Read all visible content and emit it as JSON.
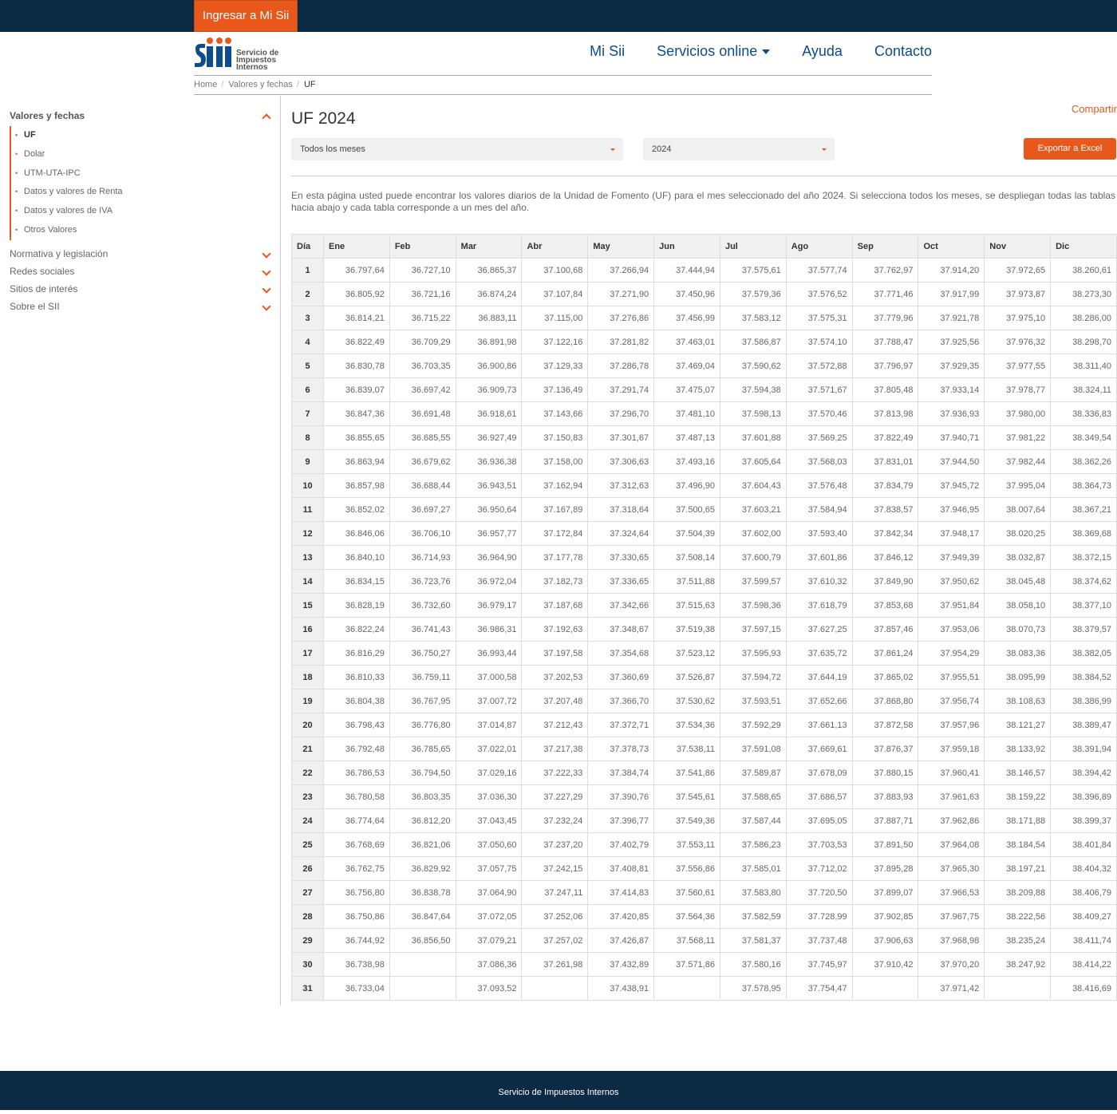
{
  "topbar": {
    "login_label": "Ingresar a Mi Sii"
  },
  "logo": {
    "line1": "Servicio de",
    "line2": "Impuestos",
    "line3": "Internos"
  },
  "nav": {
    "mi_sii": "Mi Sii",
    "servicios": "Servicios online",
    "ayuda": "Ayuda",
    "contacto": "Contacto"
  },
  "breadcrumb": {
    "home": "Home",
    "valores": "Valores y fechas",
    "current": "UF"
  },
  "sidebar": {
    "heading": "Valores y fechas",
    "items": [
      "UF",
      "Dolar",
      "UTM-UTA-IPC",
      "Datos y valores de Renta",
      "Datos y valores de IVA",
      "Otros Valores"
    ],
    "sections": [
      "Normativa y legislación",
      "Redes sociales",
      "Sitios de interés",
      "Sobre el SII"
    ]
  },
  "main": {
    "title": "UF 2024",
    "share": "Compartir",
    "month_select": "Todos los meses",
    "year_select": "2024",
    "export_label": "Exportar a Excel",
    "description": "En esta página usted puede encontrar los valores diarios de la Unidad de Fomento (UF) para el mes seleccionado del año 2024. Si selecciona todos los meses, se despliegan todas las tablas hacia abajo y cada tabla corresponde a un mes del año."
  },
  "table": {
    "headers": [
      "Día",
      "Ene",
      "Feb",
      "Mar",
      "Abr",
      "May",
      "Jun",
      "Jul",
      "Ago",
      "Sep",
      "Oct",
      "Nov",
      "Dic"
    ],
    "rows": [
      [
        "1",
        "36.797,64",
        "36.727,10",
        "36.865,37",
        "37.100,68",
        "37.266,94",
        "37.444,94",
        "37.575,61",
        "37.577,74",
        "37.762,97",
        "37.914,20",
        "37.972,65",
        "38.260,61"
      ],
      [
        "2",
        "36.805,92",
        "36.721,16",
        "36.874,24",
        "37.107,84",
        "37.271,90",
        "37.450,96",
        "37.579,36",
        "37.576,52",
        "37.771,46",
        "37.917,99",
        "37.973,87",
        "38.273,30"
      ],
      [
        "3",
        "36.814,21",
        "36.715,22",
        "36.883,11",
        "37.115,00",
        "37.276,86",
        "37.456,99",
        "37.583,12",
        "37.575,31",
        "37.779,96",
        "37.921,78",
        "37.975,10",
        "38.286,00"
      ],
      [
        "4",
        "36.822,49",
        "36.709,29",
        "36.891,98",
        "37.122,16",
        "37.281,82",
        "37.463,01",
        "37.586,87",
        "37.574,10",
        "37.788,47",
        "37.925,56",
        "37.976,32",
        "38.298,70"
      ],
      [
        "5",
        "36.830,78",
        "36.703,35",
        "36.900,86",
        "37.129,33",
        "37.286,78",
        "37.469,04",
        "37.590,62",
        "37.572,88",
        "37.796,97",
        "37.929,35",
        "37.977,55",
        "38.311,40"
      ],
      [
        "6",
        "36.839,07",
        "36.697,42",
        "36.909,73",
        "37.136,49",
        "37.291,74",
        "37.475,07",
        "37.594,38",
        "37.571,67",
        "37.805,48",
        "37.933,14",
        "37.978,77",
        "38.324,11"
      ],
      [
        "7",
        "36.847,36",
        "36.691,48",
        "36.918,61",
        "37.143,66",
        "37.296,70",
        "37.481,10",
        "37.598,13",
        "37.570,46",
        "37.813,98",
        "37.936,93",
        "37.980,00",
        "38.336,83"
      ],
      [
        "8",
        "36.855,65",
        "36.685,55",
        "36.927,49",
        "37.150,83",
        "37.301,67",
        "37.487,13",
        "37.601,88",
        "37.569,25",
        "37.822,49",
        "37.940,71",
        "37.981,22",
        "38.349,54"
      ],
      [
        "9",
        "36.863,94",
        "36.679,62",
        "36.936,38",
        "37.158,00",
        "37.306,63",
        "37.493,16",
        "37.605,64",
        "37.568,03",
        "37.831,01",
        "37.944,50",
        "37.982,44",
        "38.362,26"
      ],
      [
        "10",
        "36.857,98",
        "36.688,44",
        "36.943,51",
        "37.162,94",
        "37.312,63",
        "37.496,90",
        "37.604,43",
        "37.576,48",
        "37.834,79",
        "37.945,72",
        "37.995,04",
        "38.364,73"
      ],
      [
        "11",
        "36.852,02",
        "36.697,27",
        "36.950,64",
        "37.167,89",
        "37.318,64",
        "37.500,65",
        "37.603,21",
        "37.584,94",
        "37.838,57",
        "37.946,95",
        "38.007,64",
        "38.367,21"
      ],
      [
        "12",
        "36.846,06",
        "36.706,10",
        "36.957,77",
        "37.172,84",
        "37.324,64",
        "37.504,39",
        "37.602,00",
        "37.593,40",
        "37.842,34",
        "37.948,17",
        "38.020,25",
        "38.369,68"
      ],
      [
        "13",
        "36.840,10",
        "36.714,93",
        "36.964,90",
        "37.177,78",
        "37.330,65",
        "37.508,14",
        "37.600,79",
        "37.601,86",
        "37.846,12",
        "37.949,39",
        "38.032,87",
        "38.372,15"
      ],
      [
        "14",
        "36.834,15",
        "36.723,76",
        "36.972,04",
        "37.182,73",
        "37.336,65",
        "37.511,88",
        "37.599,57",
        "37.610,32",
        "37.849,90",
        "37.950,62",
        "38.045,48",
        "38.374,62"
      ],
      [
        "15",
        "36.828,19",
        "36.732,60",
        "36.979,17",
        "37.187,68",
        "37.342,66",
        "37.515,63",
        "37.598,36",
        "37.618,79",
        "37.853,68",
        "37.951,84",
        "38.058,10",
        "38.377,10"
      ],
      [
        "16",
        "36.822,24",
        "36.741,43",
        "36.986,31",
        "37.192,63",
        "37.348,67",
        "37.519,38",
        "37.597,15",
        "37.627,25",
        "37.857,46",
        "37.953,06",
        "38.070,73",
        "38.379,57"
      ],
      [
        "17",
        "36.816,29",
        "36.750,27",
        "36.993,44",
        "37.197,58",
        "37.354,68",
        "37.523,12",
        "37.595,93",
        "37.635,72",
        "37.861,24",
        "37.954,29",
        "38.083,36",
        "38.382,05"
      ],
      [
        "18",
        "36.810,33",
        "36.759,11",
        "37.000,58",
        "37.202,53",
        "37.360,69",
        "37.526,87",
        "37.594,72",
        "37.644,19",
        "37.865,02",
        "37.955,51",
        "38.095,99",
        "38.384,52"
      ],
      [
        "19",
        "36.804,38",
        "36.767,95",
        "37.007,72",
        "37.207,48",
        "37.366,70",
        "37.530,62",
        "37.593,51",
        "37.652,66",
        "37.868,80",
        "37.956,74",
        "38.108,63",
        "38.386,99"
      ],
      [
        "20",
        "36.798,43",
        "36.776,80",
        "37.014,87",
        "37.212,43",
        "37.372,71",
        "37.534,36",
        "37.592,29",
        "37.661,13",
        "37.872,58",
        "37.957,96",
        "38.121,27",
        "38.389,47"
      ],
      [
        "21",
        "36.792,48",
        "36.785,65",
        "37.022,01",
        "37.217,38",
        "37.378,73",
        "37.538,11",
        "37.591,08",
        "37.669,61",
        "37.876,37",
        "37.959,18",
        "38.133,92",
        "38.391,94"
      ],
      [
        "22",
        "36.786,53",
        "36.794,50",
        "37.029,16",
        "37.222,33",
        "37.384,74",
        "37.541,86",
        "37.589,87",
        "37.678,09",
        "37.880,15",
        "37.960,41",
        "38.146,57",
        "38.394,42"
      ],
      [
        "23",
        "36.780,58",
        "36.803,35",
        "37.036,30",
        "37.227,29",
        "37.390,76",
        "37.545,61",
        "37.588,65",
        "37.686,57",
        "37.883,93",
        "37.961,63",
        "38.159,22",
        "38.396,89"
      ],
      [
        "24",
        "36.774,64",
        "36.812,20",
        "37.043,45",
        "37.232,24",
        "37.396,77",
        "37.549,36",
        "37.587,44",
        "37.695,05",
        "37.887,71",
        "37.962,86",
        "38.171,88",
        "38.399,37"
      ],
      [
        "25",
        "36.768,69",
        "36.821,06",
        "37.050,60",
        "37.237,20",
        "37.402,79",
        "37.553,11",
        "37.586,23",
        "37.703,53",
        "37.891,50",
        "37.964,08",
        "38.184,54",
        "38.401,84"
      ],
      [
        "26",
        "36.762,75",
        "36.829,92",
        "37.057,75",
        "37.242,15",
        "37.408,81",
        "37.556,86",
        "37.585,01",
        "37.712,02",
        "37.895,28",
        "37.965,30",
        "38.197,21",
        "38.404,32"
      ],
      [
        "27",
        "36.756,80",
        "36.838,78",
        "37.064,90",
        "37.247,11",
        "37.414,83",
        "37.560,61",
        "37.583,80",
        "37.720,50",
        "37.899,07",
        "37.966,53",
        "38.209,88",
        "38.406,79"
      ],
      [
        "28",
        "36.750,86",
        "36.847,64",
        "37.072,05",
        "37.252,06",
        "37.420,85",
        "37.564,36",
        "37.582,59",
        "37.728,99",
        "37.902,85",
        "37.967,75",
        "38.222,56",
        "38.409,27"
      ],
      [
        "29",
        "36.744,92",
        "36.856,50",
        "37.079,21",
        "37.257,02",
        "37.426,87",
        "37.568,11",
        "37.581,37",
        "37.737,48",
        "37.906,63",
        "37.968,98",
        "38.235,24",
        "38.411,74"
      ],
      [
        "30",
        "36.738,98",
        "",
        "37.086,36",
        "37.261,98",
        "37.432,89",
        "37.571,86",
        "37.580,16",
        "37.745,97",
        "37.910,42",
        "37.970,20",
        "38.247,92",
        "38.414,22"
      ],
      [
        "31",
        "36.733,04",
        "",
        "37.093,52",
        "",
        "37.438,91",
        "",
        "37.578,95",
        "37.754,47",
        "",
        "37.971,42",
        "",
        "38.416,69"
      ]
    ]
  },
  "footer": {
    "text": "Servicio de Impuestos Internos"
  }
}
